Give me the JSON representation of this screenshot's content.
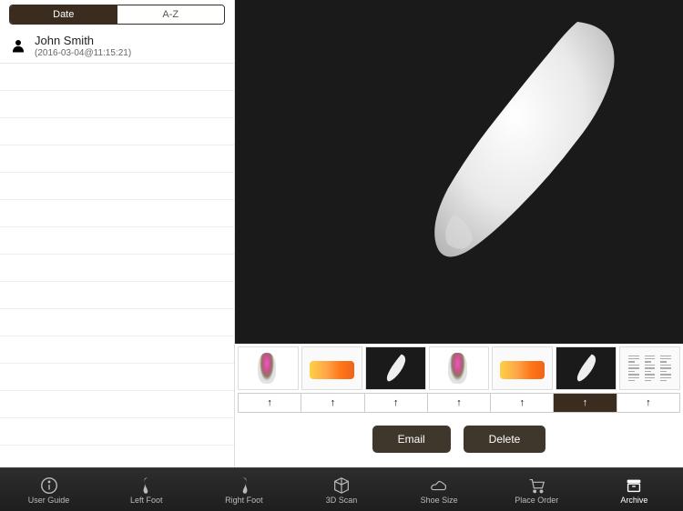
{
  "sidebar": {
    "tabs": {
      "date": "Date",
      "az": "A-Z",
      "active": "date"
    },
    "records": [
      {
        "name": "John Smith",
        "timestamp": "(2016-03-04@11:15:21)"
      }
    ],
    "empty_rows": 14
  },
  "thumbs": [
    {
      "kind": "pressure"
    },
    {
      "kind": "heatmap"
    },
    {
      "kind": "scan"
    },
    {
      "kind": "pressure"
    },
    {
      "kind": "heatmap"
    },
    {
      "kind": "scan",
      "active": true
    },
    {
      "kind": "report"
    }
  ],
  "arrow_glyph": "↑",
  "actions": {
    "email": "Email",
    "delete": "Delete"
  },
  "nav": [
    {
      "key": "user-guide",
      "label": "User Guide",
      "icon": "info"
    },
    {
      "key": "left-foot",
      "label": "Left Foot",
      "icon": "foot-l"
    },
    {
      "key": "right-foot",
      "label": "Right Foot",
      "icon": "foot-r"
    },
    {
      "key": "3d-scan",
      "label": "3D Scan",
      "icon": "cube"
    },
    {
      "key": "shoe-size",
      "label": "Shoe Size",
      "icon": "shoe"
    },
    {
      "key": "place-order",
      "label": "Place Order",
      "icon": "cart"
    },
    {
      "key": "archive",
      "label": "Archive",
      "icon": "archive",
      "active": true
    }
  ]
}
